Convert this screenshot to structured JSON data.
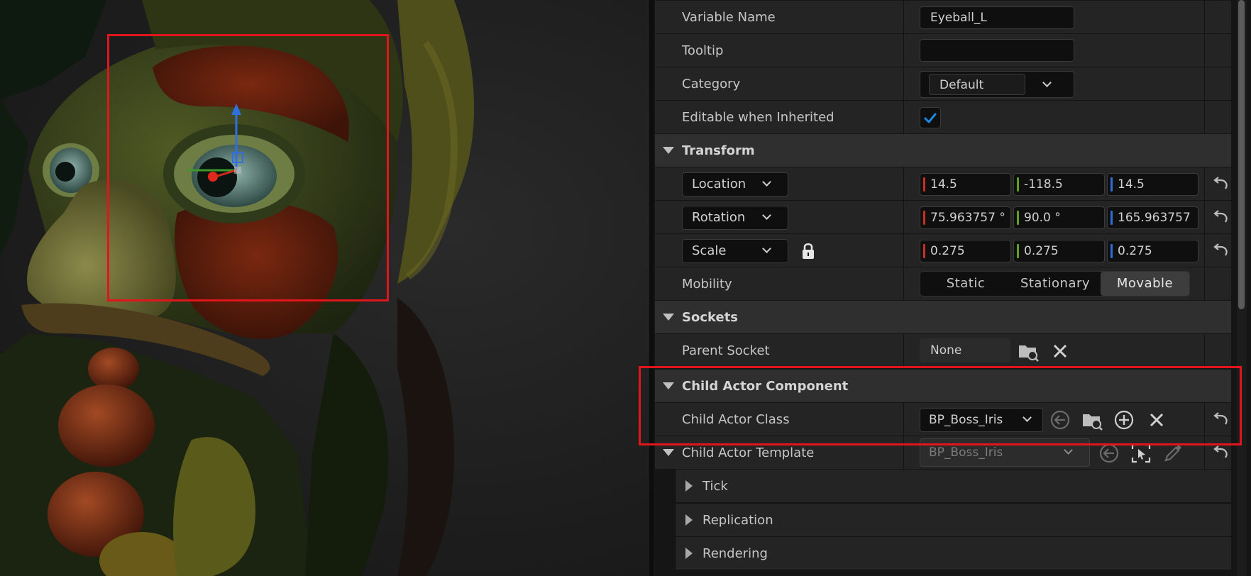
{
  "details": {
    "variable_name": {
      "label": "Variable Name",
      "value": "Eyeball_L"
    },
    "tooltip": {
      "label": "Tooltip",
      "value": ""
    },
    "category": {
      "label": "Category",
      "value": "Default"
    },
    "editable_inherited": {
      "label": "Editable when Inherited",
      "checked": true
    },
    "transform": {
      "title": "Transform",
      "location": {
        "label": "Location",
        "x": "14.5",
        "y": "-118.5",
        "z": "14.5"
      },
      "rotation": {
        "label": "Rotation",
        "x": "75.963757 °",
        "y": "90.0 °",
        "z": "165.963757"
      },
      "scale": {
        "label": "Scale",
        "x": "0.275",
        "y": "0.275",
        "z": "0.275",
        "locked": true
      },
      "mobility": {
        "label": "Mobility",
        "options": [
          "Static",
          "Stationary",
          "Movable"
        ],
        "selected": "Movable"
      }
    },
    "sockets": {
      "title": "Sockets",
      "parent_socket": {
        "label": "Parent Socket",
        "value": "None"
      }
    },
    "child_actor_component": {
      "title": "Child Actor Component",
      "child_actor_class": {
        "label": "Child Actor Class",
        "value": "BP_Boss_Iris"
      },
      "child_actor_template": {
        "label": "Child Actor Template",
        "value": "BP_Boss_Iris"
      }
    },
    "subsections": [
      "Tick",
      "Replication",
      "Rendering"
    ]
  },
  "colors": {
    "highlight": "#e0161c",
    "axis_x": "#c8311f",
    "axis_y": "#5fa01c",
    "axis_z": "#2d6fd6",
    "check_accent": "#1e88e5"
  }
}
